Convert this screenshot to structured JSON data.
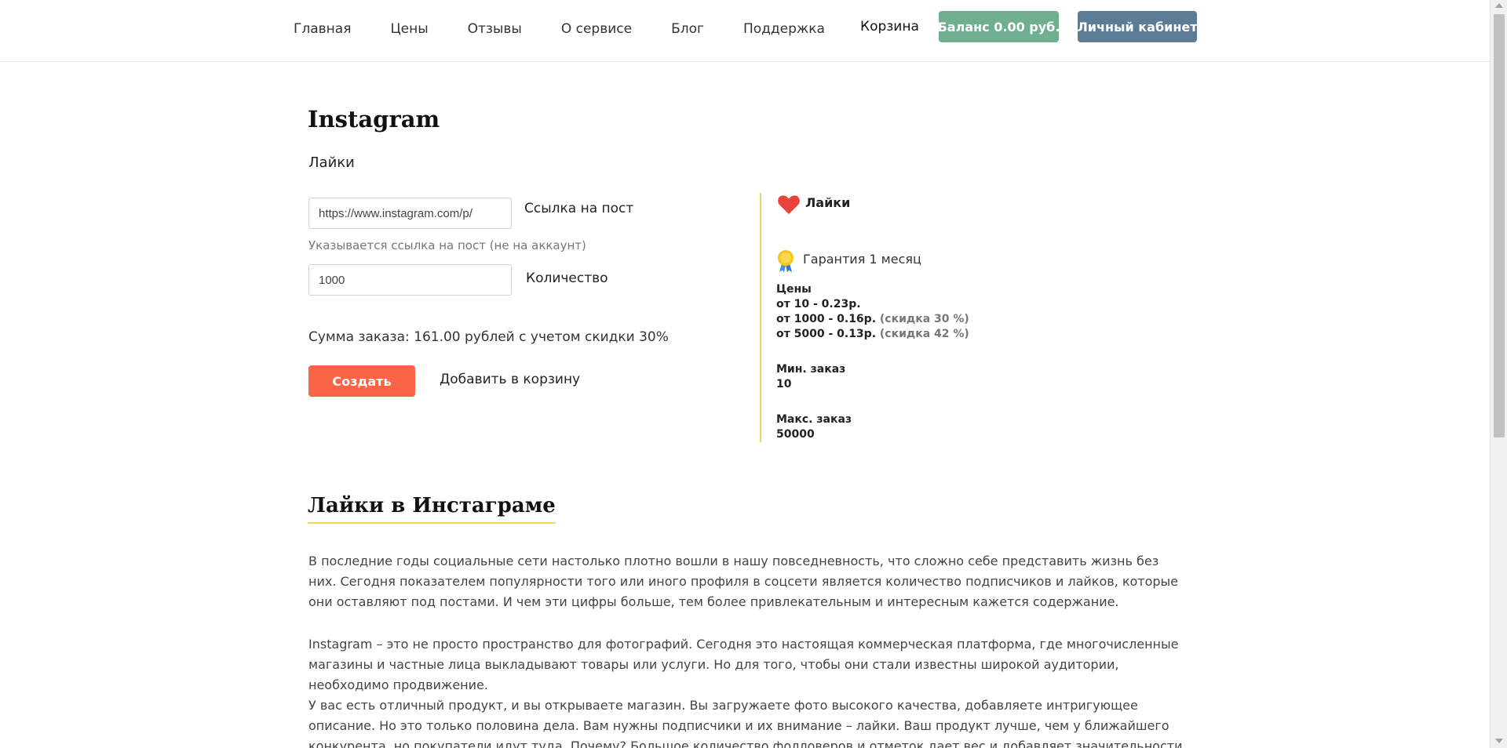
{
  "header": {
    "nav": [
      "Главная",
      "Цены",
      "Отзывы",
      "О сервисе",
      "Блог",
      "Поддержка"
    ],
    "cart": "Корзина",
    "balance_button": "Баланс 0.00 руб.",
    "cabinet_button": "Личный кабинет",
    "colors": {
      "balance": "#6fae8f",
      "cabinet": "#5c7c95"
    }
  },
  "main": {
    "title": "Instagram",
    "service": "Лайки"
  },
  "form": {
    "link_value": "https://www.instagram.com/p/",
    "link_label": "Ссылка на пост",
    "link_hint": "Указывается ссылка на пост (не на аккаунт)",
    "qty_value": "1000",
    "qty_label": "Количество",
    "sum_text": "Сумма заказа: 161.00 рублей с учетом скидки 30%",
    "create_button": "Создать",
    "add_to_cart": "Добавить в корзину",
    "colors": {
      "create": "#fc6446"
    }
  },
  "info": {
    "icon_service": "heart-icon",
    "service_title": "Лайки",
    "icon_guarantee": "medal-icon",
    "guarantee": "Гарантия 1 месяц",
    "prices_title": "Цены",
    "prices": [
      {
        "text": "от 10 - 0.23р.",
        "discount": ""
      },
      {
        "text": "от 1000 - 0.16р.",
        "discount": "(скидка 30 %)"
      },
      {
        "text": "от 5000 - 0.13р.",
        "discount": "(скидка 42 %)"
      }
    ],
    "min_label": "Мин. заказ",
    "min_value": "10",
    "max_label": "Макс. заказ",
    "max_value": "50000",
    "accent_color": "#f2d35b"
  },
  "article": {
    "title": "Лайки в Инстаграме",
    "paragraphs": [
      "В последние годы социальные сети настолько плотно вошли в нашу повседневность, что сложно себе представить жизнь без них. Сегодня показателем популярности того или иного профиля в соцсети является количество подписчиков и лайков, которые они оставляют под постами. И чем эти цифры больше, тем более привлекательным и интересным кажется содержание.",
      "Instagram – это не просто пространство для фотографий. Сегодня это настоящая коммерческая платформа, где многочисленные магазины и частные лица выкладывают товары или услуги. Но для того, чтобы они стали известны широкой аудитории, необходимо продвижение.",
      "У вас есть отличный продукт, и вы открываете магазин. Вы загружаете фото высокого качества, добавляете интригующее описание. Но это только половина дела. Вам нужны подписчики и их внимание – лайки. Ваш продукт лучше, чем у ближайшего конкурента, но покупатели идут туда. Почему? Большое количество фолловеров и отметок дает вес и добавляет значительности странице. Они показывают ее популярность, а"
    ]
  }
}
